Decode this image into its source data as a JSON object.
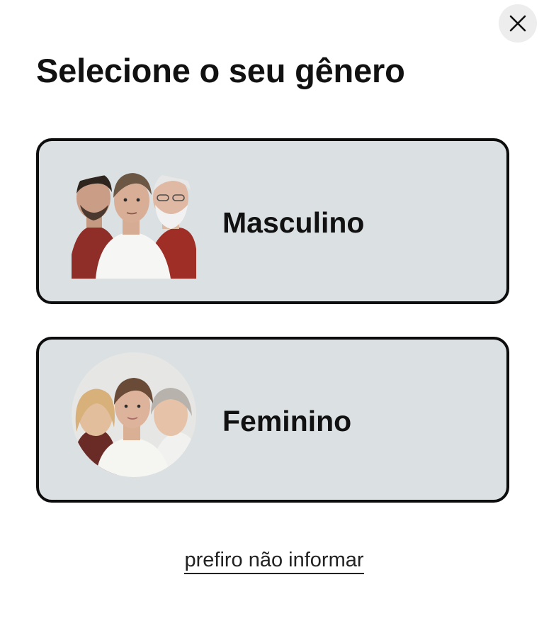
{
  "dialog": {
    "title": "Selecione o seu gênero",
    "close_icon": "close-icon"
  },
  "options": [
    {
      "label": "Masculino",
      "icon": "male-group-avatar"
    },
    {
      "label": "Feminino",
      "icon": "female-group-avatar"
    }
  ],
  "skip_label": "prefiro não informar",
  "colors": {
    "card_background": "#dbe0e3",
    "card_border": "#0d0d0d",
    "close_button_bg": "#ededed",
    "text": "#111111"
  }
}
